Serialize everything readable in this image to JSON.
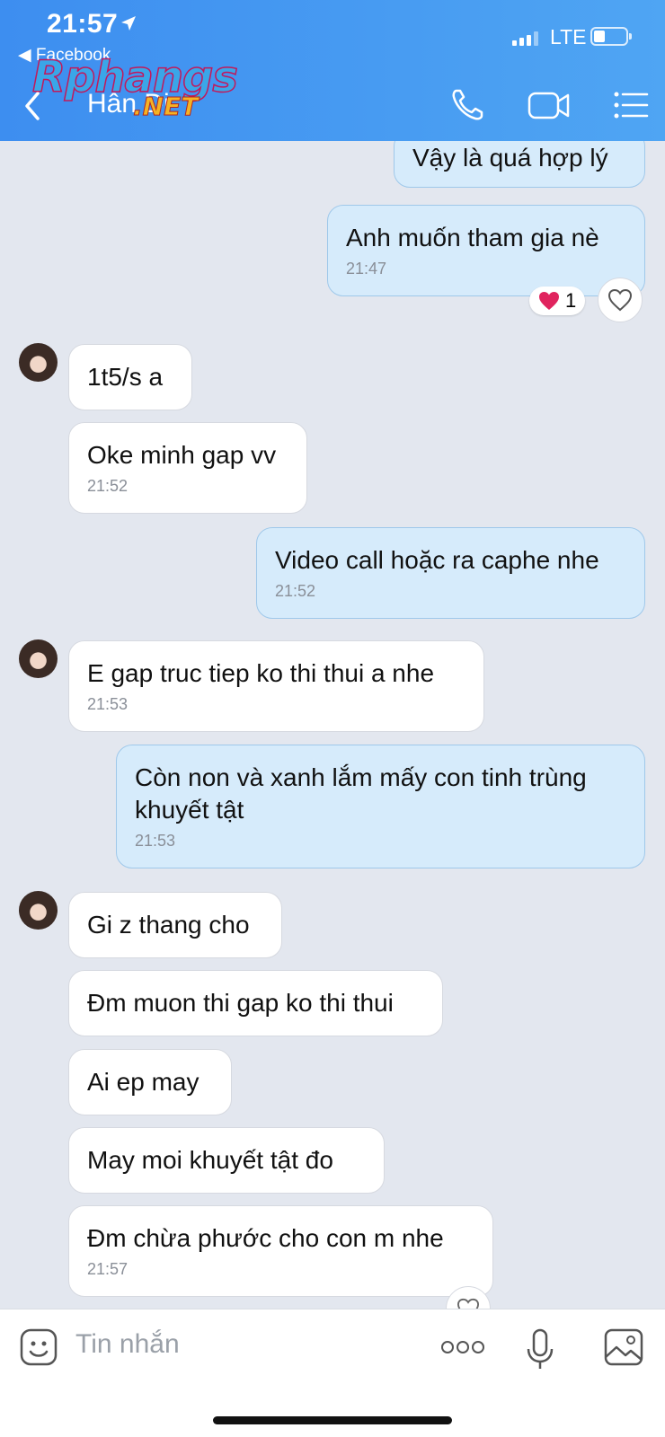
{
  "status_bar": {
    "time": "21:57",
    "back_app": "◀ Facebook",
    "network": "LTE"
  },
  "header": {
    "contact_name": "Hân Di"
  },
  "watermark": {
    "main": "Rphangs",
    "suffix": ".NET"
  },
  "messages": [
    {
      "text": "Vậy là quá hợp lý"
    },
    {
      "text": "Anh muốn tham gia nè",
      "time": "21:47",
      "reaction_count": "1"
    },
    {
      "text": "1t5/s a"
    },
    {
      "text": "Oke minh gap vv",
      "time": "21:52"
    },
    {
      "text": "Video call hoặc ra caphe nhe",
      "time": "21:52"
    },
    {
      "text": "E gap truc tiep ko thi thui a nhe",
      "time": "21:53"
    },
    {
      "text": "Còn non và xanh lắm mấy con tinh trùng khuyết tật",
      "time": "21:53"
    },
    {
      "text": "Gi z thang cho"
    },
    {
      "text": "Đm muon thi gap ko thi thui"
    },
    {
      "text": "Ai ep may"
    },
    {
      "text": "May moi khuyết tật đo"
    },
    {
      "text": "Đm chừa phước cho con m nhe",
      "time": "21:57"
    }
  ],
  "composer": {
    "placeholder": "Tin nhắn"
  },
  "icons": [
    "location-arrow-icon",
    "back-chevron-icon",
    "phone-icon",
    "video-camera-icon",
    "menu-list-icon",
    "heart-icon",
    "like-heart-icon",
    "sticker-face-icon",
    "more-dots-icon",
    "microphone-icon",
    "image-icon"
  ],
  "colors": {
    "header_start": "#3d8ef0",
    "header_end": "#4fa5f3",
    "outgoing_bubble": "#d6ebfb",
    "incoming_bubble": "#ffffff",
    "chat_background": "#e3e7ef",
    "heart": "#e0245e"
  }
}
